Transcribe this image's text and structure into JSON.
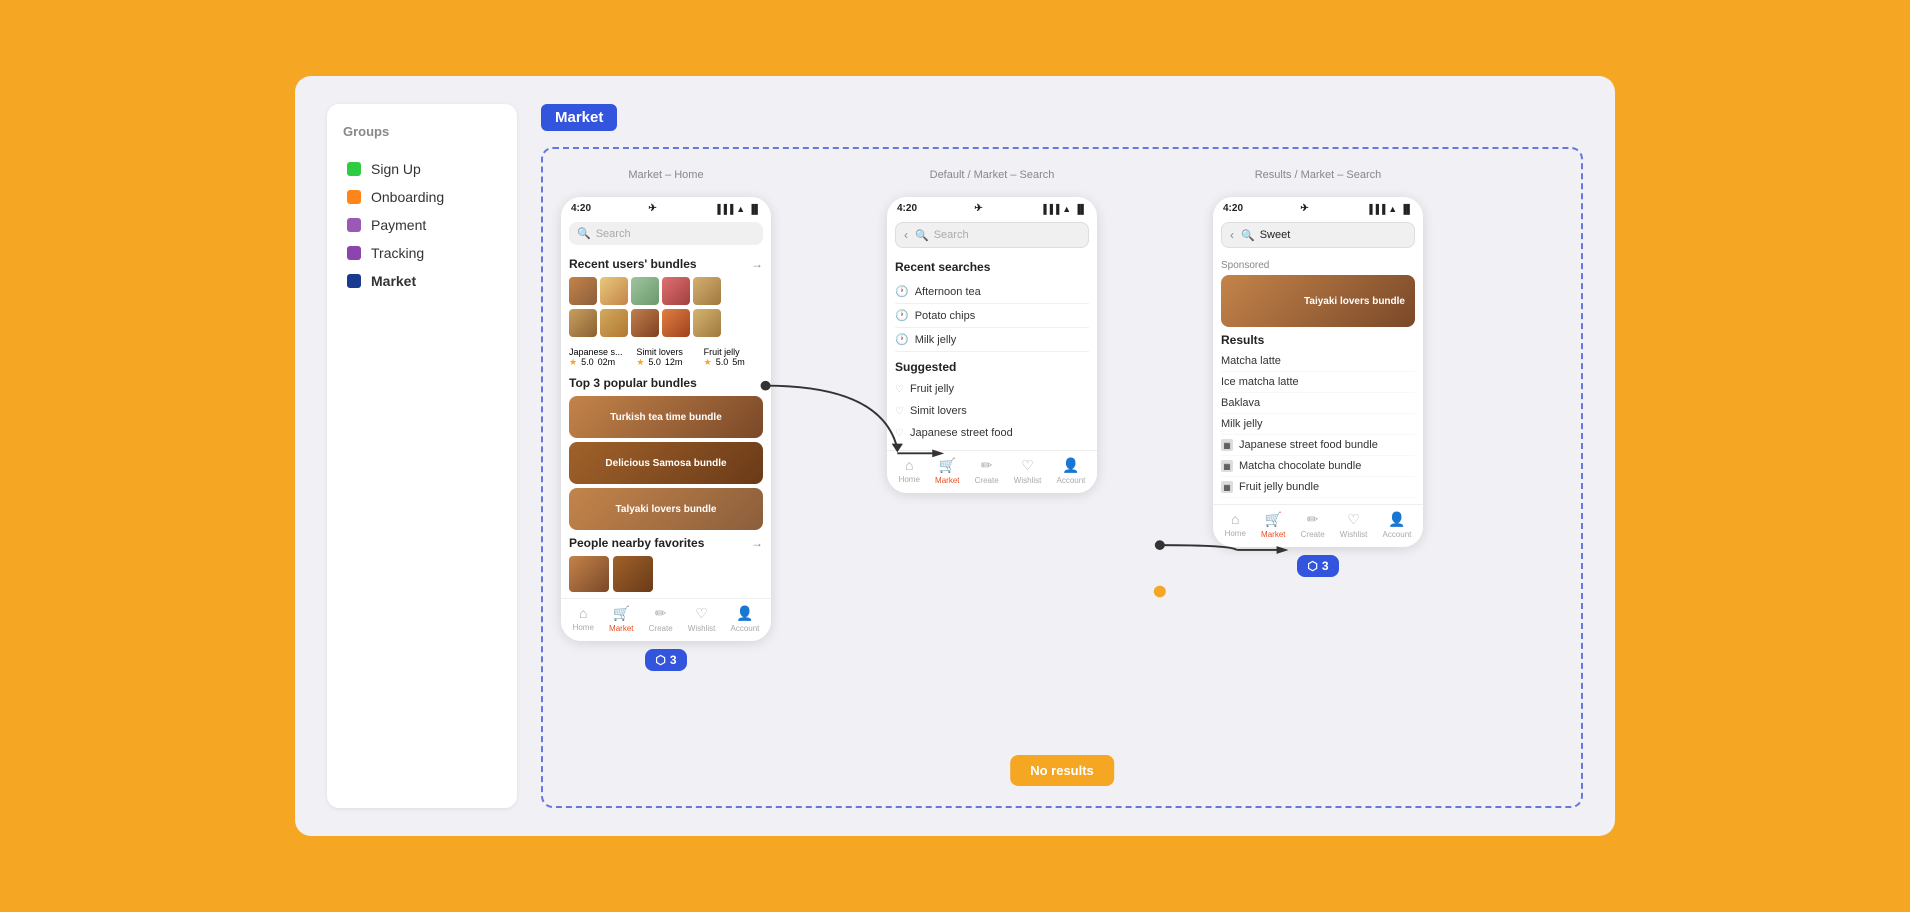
{
  "sidebar": {
    "title": "Groups",
    "items": [
      {
        "label": "Sign Up",
        "color": "#2ECC40",
        "active": false
      },
      {
        "label": "Onboarding",
        "color": "#FF851B",
        "active": false
      },
      {
        "label": "Payment",
        "color": "#9B59B6",
        "active": false
      },
      {
        "label": "Tracking",
        "color": "#8E44AD",
        "active": false
      },
      {
        "label": "Market",
        "color": "#1A3A8F",
        "active": true
      }
    ]
  },
  "market_label": "Market",
  "screens": {
    "screen1": {
      "label": "Market – Home",
      "time": "4:20",
      "search_placeholder": "Search",
      "recent_bundles_title": "Recent users' bundles",
      "bundle1_name": "Japanese s...",
      "bundle1_rating": "5.0",
      "bundle1_time": "02m",
      "bundle2_name": "Simit lovers",
      "bundle2_rating": "5.0",
      "bundle2_time": "12m",
      "bundle3_name": "Fruit jelly",
      "bundle3_rating": "5.0",
      "bundle3_time": "5m",
      "top3_title": "Top 3 popular bundles",
      "top3_items": [
        "Turkish tea time bundle",
        "Delicious Samosa bundle",
        "Talyaki lovers bundle"
      ],
      "nearby_title": "People nearby favorites",
      "nav_items": [
        "Home",
        "Market",
        "Create",
        "Wishlist",
        "Account"
      ]
    },
    "screen2": {
      "label": "Default / Market – Search",
      "time": "4:20",
      "search_placeholder": "Search",
      "recent_searches_title": "Recent searches",
      "recent_items": [
        "Afternoon tea",
        "Potato chips",
        "Milk jelly"
      ],
      "suggested_title": "Suggested",
      "suggested_items": [
        "Fruit jelly",
        "Simit lovers",
        "Japanese street food"
      ],
      "nav_items": [
        "Home",
        "Market",
        "Create",
        "Wishlist",
        "Account"
      ]
    },
    "screen3": {
      "label": "Results / Market – Search",
      "time": "4:20",
      "search_value": "Sweet",
      "sponsored_label": "Sponsored",
      "sponsored_item": "Taiyaki lovers bundle",
      "results_title": "Results",
      "result_items": [
        {
          "name": "Matcha latte",
          "type": "item"
        },
        {
          "name": "Ice matcha latte",
          "type": "item"
        },
        {
          "name": "Baklava",
          "type": "item"
        },
        {
          "name": "Milk jelly",
          "type": "item"
        },
        {
          "name": "Japanese street food bundle",
          "type": "bundle"
        },
        {
          "name": "Matcha chocolate bundle",
          "type": "bundle"
        },
        {
          "name": "Fruit jelly bundle",
          "type": "bundle"
        }
      ],
      "nav_items": [
        "Home",
        "Market",
        "Create",
        "Wishlist",
        "Account"
      ]
    }
  },
  "badges": {
    "layer1": "3",
    "layer2": "3"
  },
  "no_results": "No results"
}
